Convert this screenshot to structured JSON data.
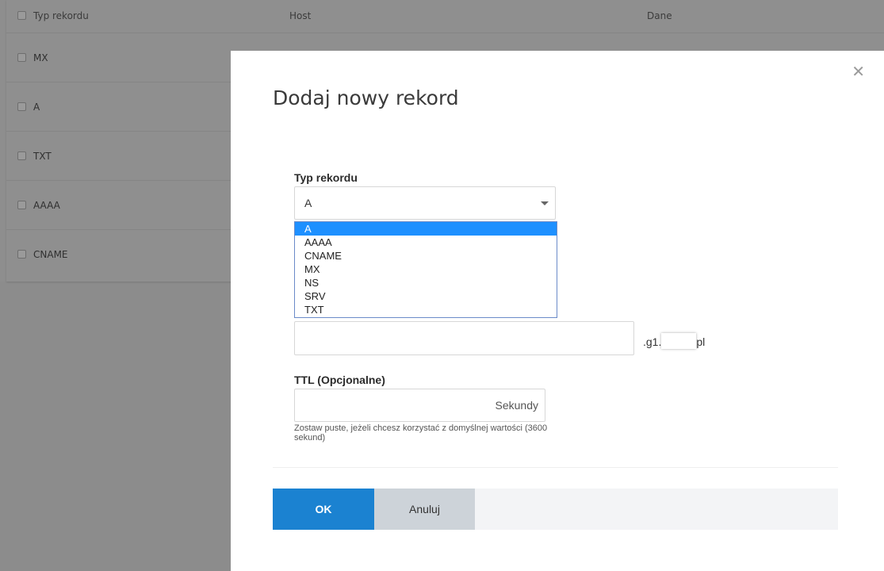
{
  "background_table": {
    "columns": [
      "Typ rekordu",
      "Host",
      "Dane"
    ],
    "rows": [
      "MX",
      "A",
      "TXT",
      "AAAA",
      "CNAME"
    ]
  },
  "modal": {
    "title": "Dodaj nowy rekord",
    "close_icon": "close-icon",
    "record_type": {
      "label": "Typ rekordu",
      "selected": "A",
      "options": [
        "A",
        "AAAA",
        "CNAME",
        "MX",
        "NS",
        "SRV",
        "TXT"
      ]
    },
    "host": {
      "value": "",
      "suffix_prefix": ".g1.",
      "suffix_end": "pl"
    },
    "ttl": {
      "label": "TTL (Opcjonalne)",
      "value": "",
      "unit": "Sekundy",
      "hint": "Zostaw puste, jeżeli chcesz korzystać z domyślnej wartości (3600 sekund)"
    },
    "buttons": {
      "ok": "OK",
      "cancel": "Anuluj"
    }
  },
  "colors": {
    "primary": "#1b82d1",
    "selected_option": "#1e90ff",
    "overlay": "#8c8c8c"
  }
}
